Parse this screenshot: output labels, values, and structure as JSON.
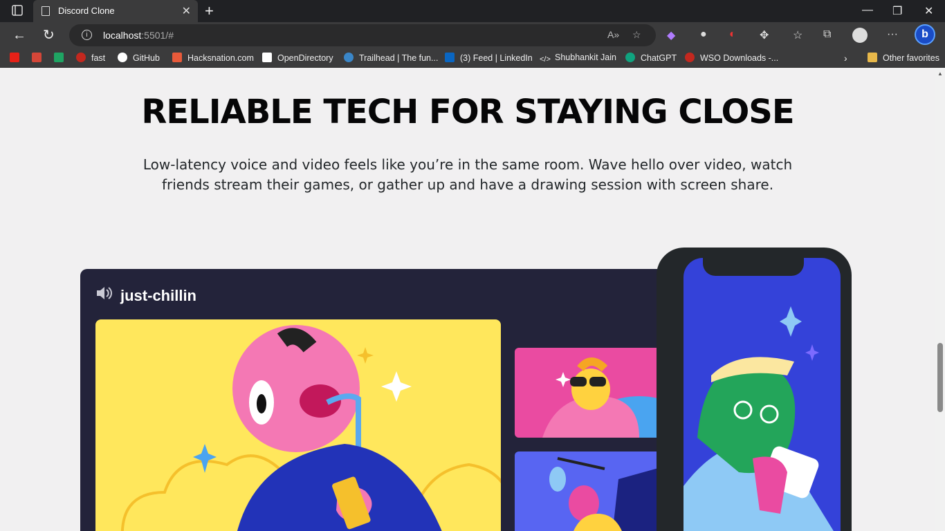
{
  "browser": {
    "tab_title": "Discord Clone",
    "url_host": "localhost",
    "url_path": ":5501/#",
    "bookmarks": [
      "fast",
      "GitHub",
      "Hacksnation.com",
      "OpenDirectory",
      "Trailhead | The fun...",
      "(3) Feed | LinkedIn",
      "Shubhankit Jain",
      "ChatGPT",
      "WSO Downloads -...",
      "Other favorites"
    ]
  },
  "page": {
    "heading": "RELIABLE TECH FOR STAYING CLOSE",
    "subtext": "Low-latency voice and video feels like you’re in the same room. Wave hello over video, watch friends stream their games, or gather up and have a drawing session with screen share.",
    "channel_name": "just-chillin"
  }
}
